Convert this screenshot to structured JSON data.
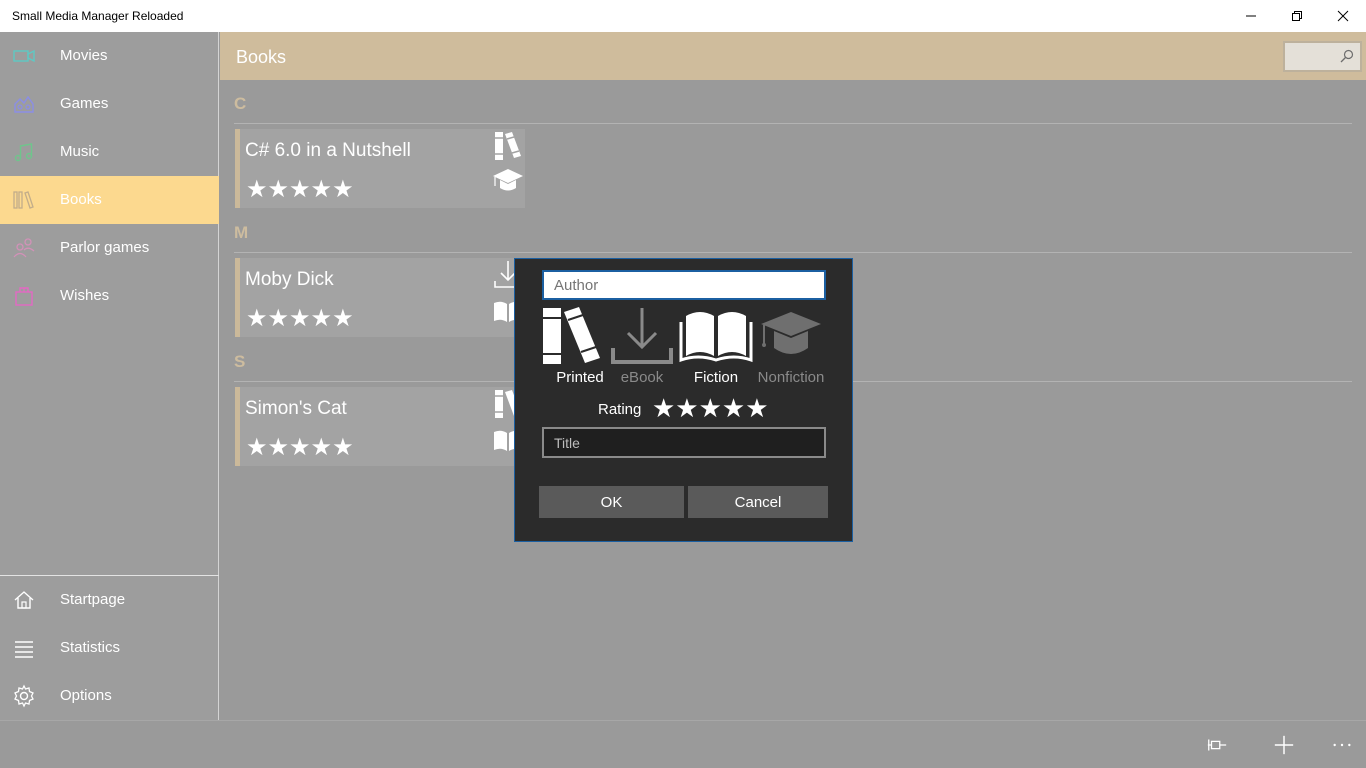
{
  "window": {
    "title": "Small Media Manager Reloaded"
  },
  "sidebar": {
    "items": [
      {
        "label": "Movies",
        "icon": "video-camera-icon",
        "color": "#5ec9c4"
      },
      {
        "label": "Games",
        "icon": "game-icon",
        "color": "#8b8ee6"
      },
      {
        "label": "Music",
        "icon": "music-note-icon",
        "color": "#6fc58c"
      },
      {
        "label": "Books",
        "icon": "books-icon",
        "color": "#c2ad8a",
        "selected": true
      },
      {
        "label": "Parlor games",
        "icon": "people-icon",
        "color": "#d291b8"
      },
      {
        "label": "Wishes",
        "icon": "gift-icon",
        "color": "#e468c4"
      }
    ],
    "bottom_items": [
      {
        "label": "Startpage",
        "icon": "home-icon"
      },
      {
        "label": "Statistics",
        "icon": "list-icon"
      },
      {
        "label": "Options",
        "icon": "gear-icon"
      }
    ]
  },
  "header": {
    "title": "Books",
    "search_placeholder": ""
  },
  "groups": [
    {
      "letter": "C",
      "books": [
        {
          "title": "C# 6.0 in a Nutshell",
          "rating": "★★★★★",
          "format": "printed",
          "genre": "nonfiction"
        }
      ]
    },
    {
      "letter": "M",
      "books": [
        {
          "title": "Moby Dick",
          "rating": "★★★★★",
          "format": "ebook",
          "genre": "fiction"
        }
      ]
    },
    {
      "letter": "S",
      "books": [
        {
          "title": "Simon's Cat",
          "rating": "★★★★★",
          "format": "printed",
          "genre": "fiction"
        }
      ]
    }
  ],
  "dialog": {
    "author_placeholder": "Author",
    "types": [
      {
        "label": "Printed",
        "icon": "printed-books-icon",
        "active": true
      },
      {
        "label": "eBook",
        "icon": "download-icon",
        "active": false
      },
      {
        "label": "Fiction",
        "icon": "open-book-icon",
        "active": true
      },
      {
        "label": "Nonfiction",
        "icon": "graduation-cap-icon",
        "active": false
      }
    ],
    "rating_label": "Rating",
    "rating_stars": "★★★★★",
    "title_placeholder": "Title",
    "ok_label": "OK",
    "cancel_label": "Cancel"
  },
  "bottom_bar": {
    "buttons": [
      "pin-icon",
      "add-icon",
      "more-icon"
    ]
  },
  "colors": {
    "accent_header": "#cfbc9c",
    "selected_nav": "#fcd98f",
    "dialog_bg": "#2b2b2b",
    "dialog_border": "#1b5fa1"
  }
}
